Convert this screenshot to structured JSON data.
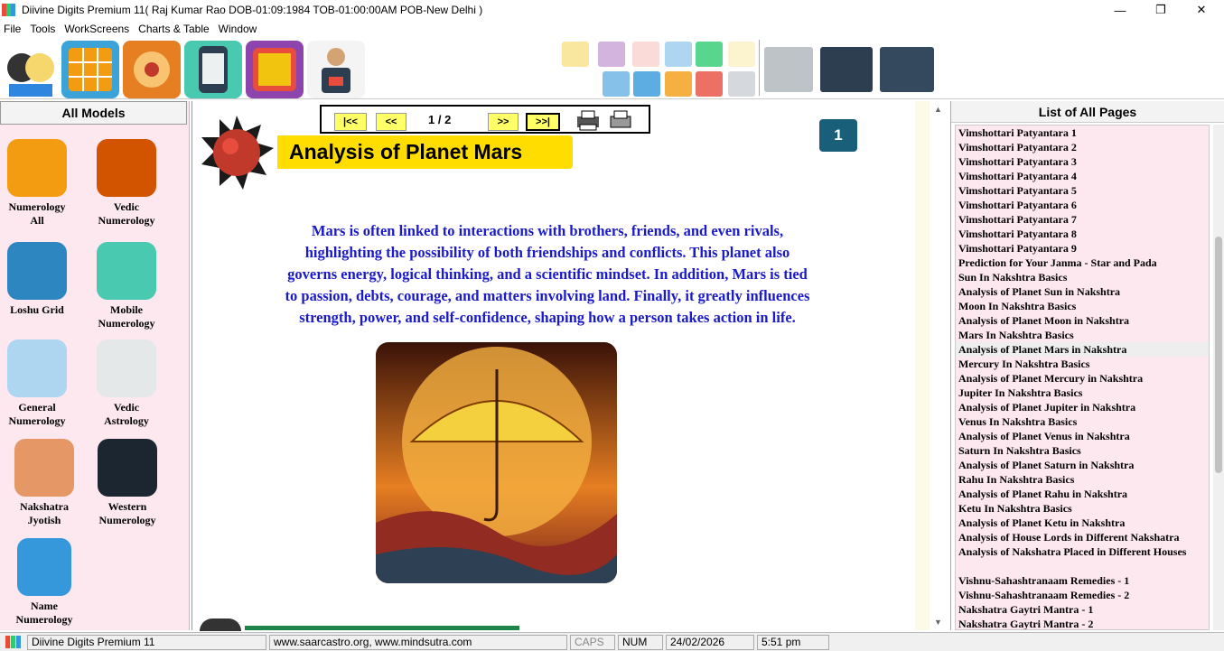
{
  "window": {
    "title": "Diivine Digits Premium 11( Raj Kumar Rao DOB-01:09:1984 TOB-01:00:00AM POB-New Delhi )",
    "minimize": "—",
    "restore": "❐",
    "close": "✕"
  },
  "menu": [
    "File",
    "Tools",
    "WorkScreens",
    "Charts & Table",
    "Window"
  ],
  "left_panel": {
    "title": "All Models",
    "models": [
      {
        "label1": "Numerology",
        "label2": "All"
      },
      {
        "label1": "Vedic",
        "label2": "Numerology"
      },
      {
        "label1": "Loshu Grid",
        "label2": ""
      },
      {
        "label1": "Mobile",
        "label2": "Numerology"
      },
      {
        "label1": "General",
        "label2": "Numerology"
      },
      {
        "label1": "Vedic",
        "label2": "Astrology"
      },
      {
        "label1": "Nakshatra",
        "label2": "Jyotish"
      },
      {
        "label1": "Western",
        "label2": "Numerology"
      },
      {
        "label1": "Name",
        "label2": "Numerology"
      }
    ]
  },
  "nav": {
    "first": "|<<",
    "prev": "<<",
    "page": "1 / 2",
    "next": ">>",
    "last": ">>|"
  },
  "page_badge": "1",
  "content": {
    "heading": "Analysis of Planet Mars",
    "lines": [
      "Mars is often linked to interactions with brothers, friends, and even rivals,",
      "highlighting the possibility of both friendships and conflicts. This planet also",
      "governs energy, logical thinking, and a scientific mindset. In addition, Mars is tied",
      "to passion, debts, courage, and matters involving land. Finally, it greatly influences",
      "strength, power, and self-confidence, shaping how a person takes action in life."
    ]
  },
  "right_panel": {
    "title": "List of All Pages",
    "items": [
      "Vimshottari Patyantara 1",
      "Vimshottari Patyantara 2",
      "Vimshottari Patyantara 3",
      "Vimshottari Patyantara 4",
      "Vimshottari Patyantara 5",
      "Vimshottari Patyantara 6",
      "Vimshottari Patyantara 7",
      "Vimshottari Patyantara 8",
      "Vimshottari Patyantara 9",
      "Prediction for Your Janma - Star and Pada",
      "Sun In Nakshtra Basics",
      "Analysis of Planet Sun in Nakshtra",
      "Moon In Nakshtra Basics",
      "Analysis of Planet Moon in Nakshtra",
      "Mars In Nakshtra Basics",
      "Analysis of Planet Mars in Nakshtra",
      "Mercury In Nakshtra Basics",
      "Analysis of Planet Mercury in Nakshtra",
      "Jupiter In Nakshtra Basics",
      "Analysis of Planet Jupiter in Nakshtra",
      "Venus In Nakshtra Basics",
      "Analysis of Planet Venus in Nakshtra",
      "Saturn In Nakshtra Basics",
      "Analysis of Planet Saturn in Nakshtra",
      "Rahu In Nakshtra Basics",
      "Analysis of Planet Rahu in Nakshtra",
      "Ketu In Nakshtra Basics",
      "Analysis of Planet Ketu in Nakshtra",
      "Analysis of House Lords in Different Nakshatra",
      "Analysis of Nakshatra Placed in Different Houses",
      "",
      "Vishnu-Sahashtranaam Remedies - 1",
      "Vishnu-Sahashtranaam Remedies - 2",
      "Nakshatra Gaytri Mantra - 1",
      "Nakshatra Gaytri Mantra - 2"
    ],
    "selected_index": 15
  },
  "statusbar": {
    "app": "Diivine Digits Premium 11",
    "web": "www.saarcastro.org, www.mindsutra.com",
    "caps": "CAPS",
    "num": "NUM",
    "date": "24/02/2026",
    "time": "5:51 pm"
  },
  "colors": {
    "heading_bg": "#ffdd00",
    "body_text": "#1a1acc",
    "badge_bg": "#1a5f7a",
    "panel_bg": "#fde8ef",
    "nav_btn": "#ffff66"
  },
  "icons": [
    "app-logo-icon",
    "user-faces-icon",
    "loshu-grid-icon",
    "lotus-icon",
    "mobile-icon",
    "vedic-grid-icon",
    "astrologer-icon",
    "calendar-icon",
    "font-icon",
    "target-icon",
    "dots-icon",
    "seven-icon",
    "bulb-icon",
    "printer-icon",
    "ink-printer-icon",
    "fax-icon"
  ]
}
